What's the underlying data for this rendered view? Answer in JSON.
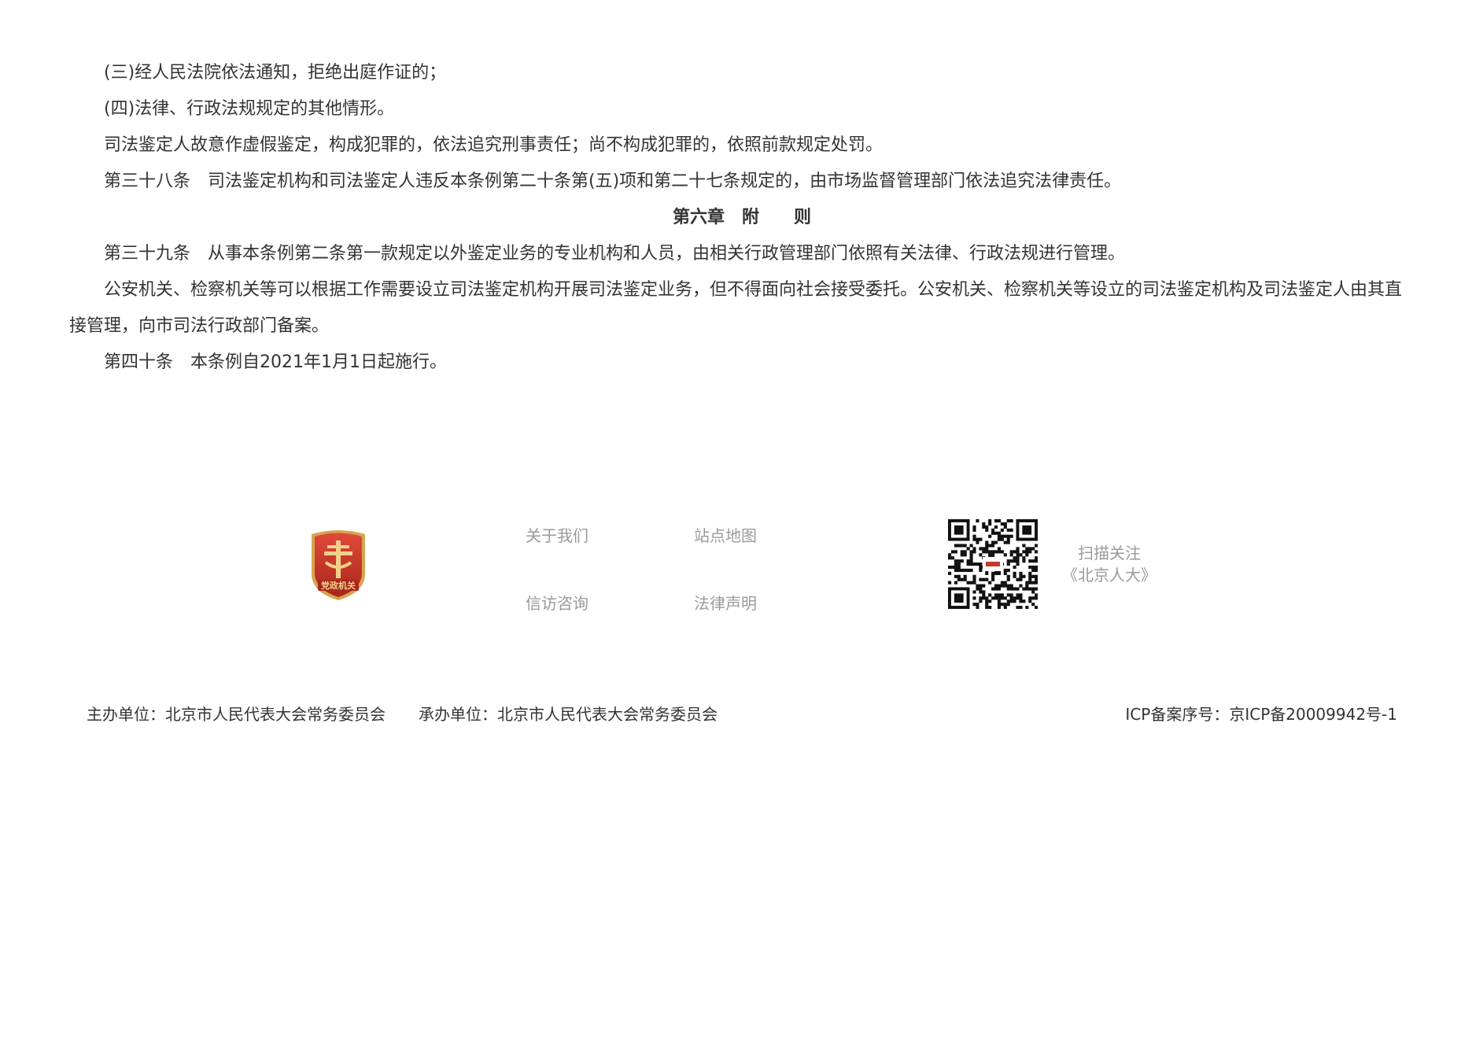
{
  "article": {
    "paragraphs": [
      {
        "type": "para",
        "text": "(三)经人民法院依法通知，拒绝出庭作证的；"
      },
      {
        "type": "para",
        "text": "(四)法律、行政法规规定的其他情形。"
      },
      {
        "type": "para",
        "text": "司法鉴定人故意作虚假鉴定，构成犯罪的，依法追究刑事责任；尚不构成犯罪的，依照前款规定处罚。"
      },
      {
        "type": "para",
        "text": "第三十八条　司法鉴定机构和司法鉴定人违反本条例第二十条第(五)项和第二十七条规定的，由市场监督管理部门依法追究法律责任。"
      },
      {
        "type": "chapter",
        "text": "第六章　附　　则"
      },
      {
        "type": "para",
        "text": "第三十九条　从事本条例第二条第一款规定以外鉴定业务的专业机构和人员，由相关行政管理部门依照有关法律、行政法规进行管理。"
      },
      {
        "type": "para",
        "text": "公安机关、检察机关等可以根据工作需要设立司法鉴定机构开展司法鉴定业务，但不得面向社会接受委托。公安机关、检察机关等设立的司法鉴定机构及司法鉴定人由其直接管理，向市司法行政部门备案。"
      },
      {
        "type": "para",
        "text": "第四十条　本条例自2021年1月1日起施行。"
      }
    ]
  },
  "footer": {
    "emblem_text": "党政机关",
    "emblem_icon": "party-government-emblem-icon",
    "links": {
      "about": "关于我们",
      "sitemap": "站点地图",
      "petition": "信访咨询",
      "legal": "法律声明"
    },
    "qr_icon": "qr-code-icon",
    "qr_caption_line1": "扫描关注",
    "qr_caption_line2": "《北京人大》",
    "sponsor": "主办单位：北京市人民代表大会常务委员会",
    "organizer": "承办单位：北京市人民代表大会常务委员会",
    "icp": "ICP备案序号：京ICP备20009942号-1"
  },
  "colors": {
    "body_text": "#333333",
    "muted_link": "#9a9a9a",
    "emblem_red": "#c0392b",
    "emblem_gold": "#d4a650"
  }
}
